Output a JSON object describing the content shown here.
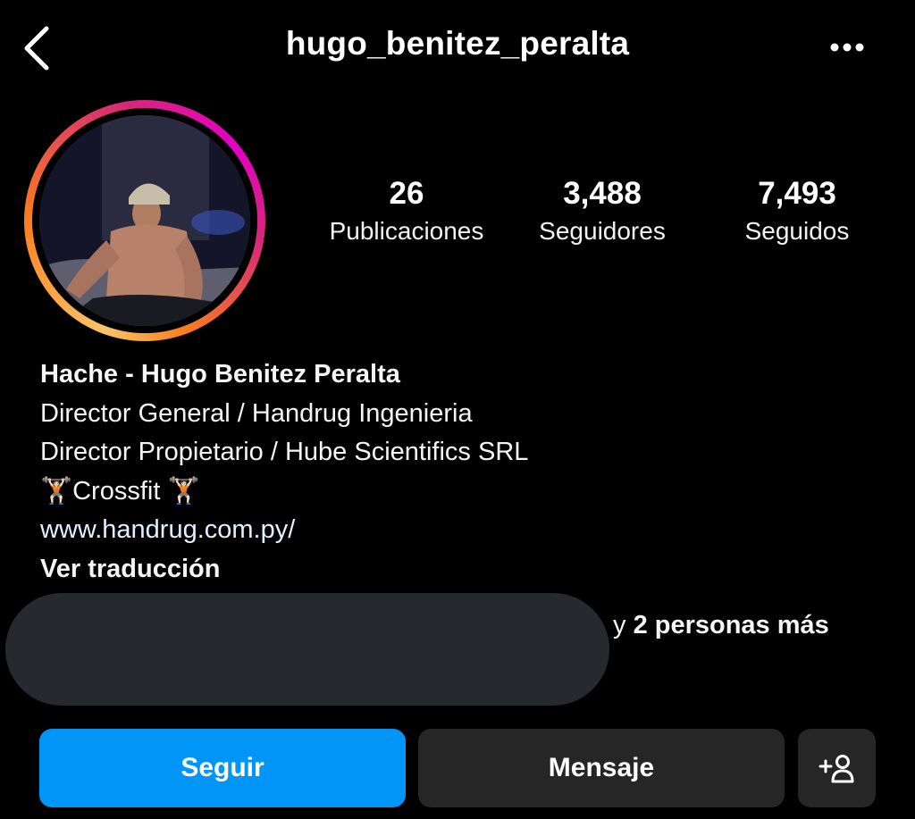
{
  "header": {
    "username": "hugo_benitez_peralta",
    "back_icon": "chevron-left-icon",
    "more_icon": "more-horizontal-icon"
  },
  "stats": {
    "posts": {
      "value": "26",
      "label": "Publicaciones"
    },
    "followers": {
      "value": "3,488",
      "label": "Seguidores"
    },
    "following": {
      "value": "7,493",
      "label": "Seguidos"
    }
  },
  "bio": {
    "name": "Hache - Hugo Benitez Peralta",
    "line1": "Director General / Handrug Ingenieria",
    "line2": "Director Propietario / Hube Scientifics SRL",
    "line3_emoji": "🏋🏻",
    "line3_text": "Crossfit",
    "link": "www.handrug.com.py/",
    "translate": "Ver traducción"
  },
  "followed_by": {
    "prefix": "y",
    "bold": "2 personas más"
  },
  "actions": {
    "follow_label": "Seguir",
    "message_label": "Mensaje",
    "suggest_icon": "add-person-icon"
  },
  "colors": {
    "background": "#000000",
    "primary_button": "#0095f6",
    "secondary_button": "#262626",
    "link": "#e0f1ff",
    "story_ring": [
      "#fdc468",
      "#fa7e1e",
      "#d62976",
      "#e300c4"
    ]
  }
}
